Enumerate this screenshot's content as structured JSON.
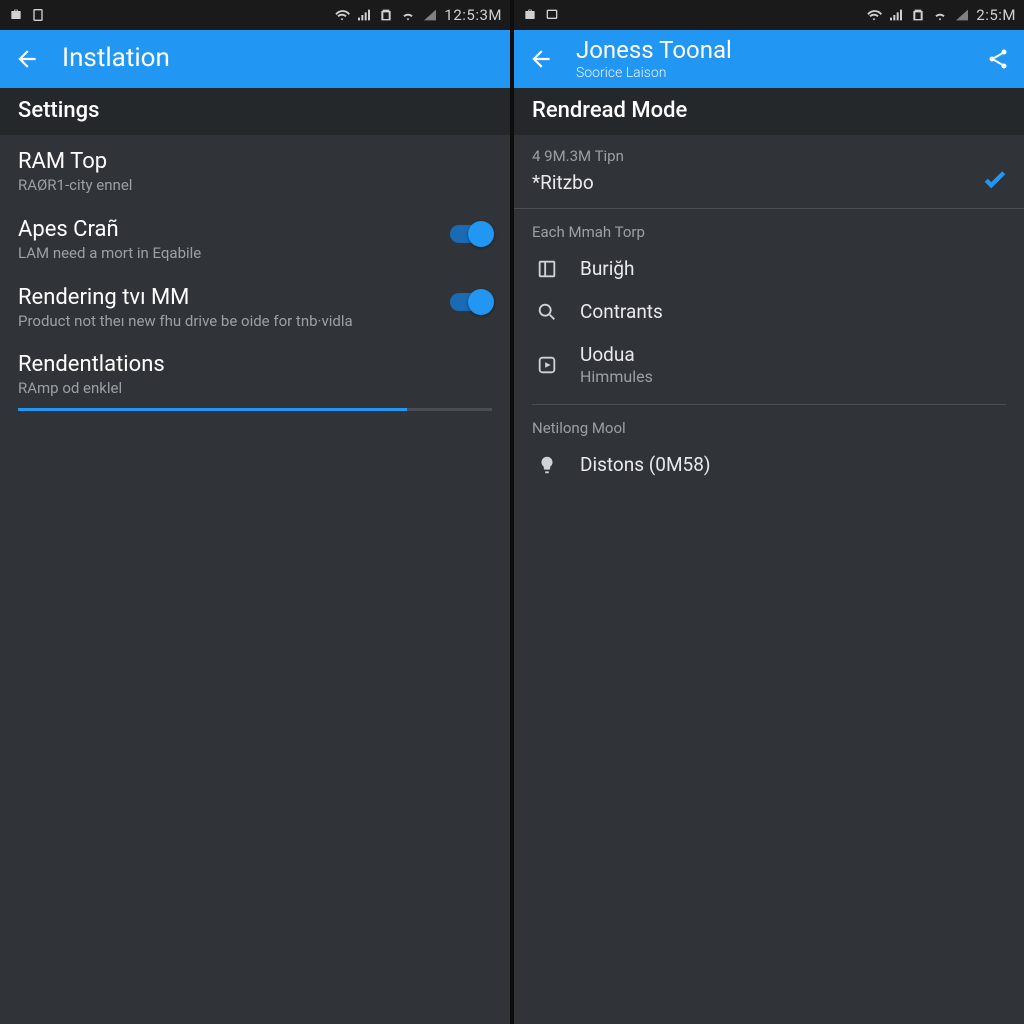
{
  "colors": {
    "accent": "#2196f3",
    "bg": "#303438",
    "text_dim": "#9aa0a6"
  },
  "left": {
    "status": {
      "clock": "12:5:3M"
    },
    "actionbar": {
      "title": "Instlation"
    },
    "section": "Settings",
    "settings": [
      {
        "title": "RAM Top",
        "sub": "RAØR1-city ennel",
        "toggle": null
      },
      {
        "title": "Apes Crañ",
        "sub": "LAM need a mort in Eqabile",
        "toggle": true
      },
      {
        "title": "Rendering tvı MM",
        "sub": "Product not theı new fhu drive be oide for tnb·vidla",
        "toggle": true
      },
      {
        "title": "Rendentlations",
        "sub": "RAmp od enklel",
        "toggle": null,
        "progress": 82
      }
    ]
  },
  "right": {
    "status": {
      "clock": "2:5:M"
    },
    "actionbar": {
      "title": "Joness Toonal",
      "subtitle": "Soorice Laison"
    },
    "section": "Rendread Mode",
    "mode": {
      "hint": "4 9M.3M Tipn",
      "selected": "*Ritzbo"
    },
    "group1": {
      "label": "Each Mmah Torp",
      "items": [
        {
          "icon": "layout-icon",
          "label": "Buriğh"
        },
        {
          "icon": "search-icon",
          "label": "Contrants"
        },
        {
          "icon": "play-box-icon",
          "label": "Uodua",
          "sub": "Himmules"
        }
      ]
    },
    "group2": {
      "label": "Netilong Mool",
      "items": [
        {
          "icon": "bulb-icon",
          "label": "Distons (0M58)"
        }
      ]
    }
  }
}
